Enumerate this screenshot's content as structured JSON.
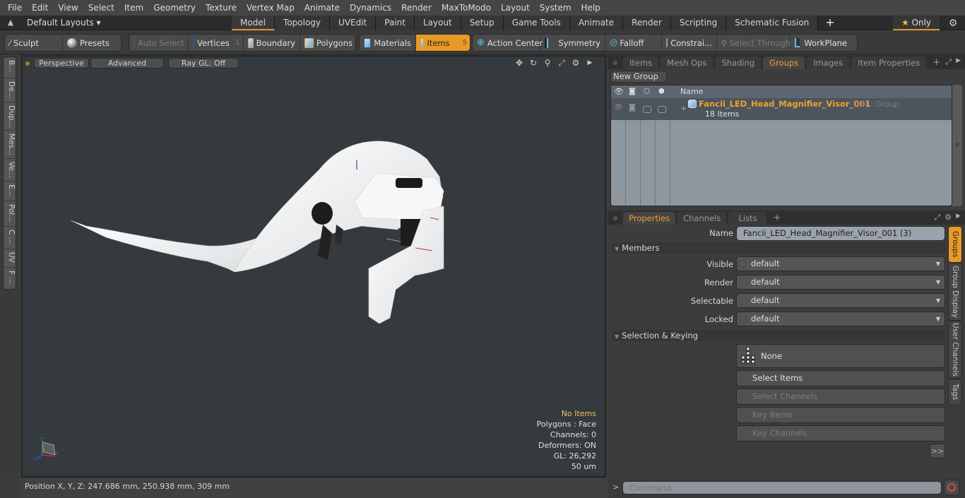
{
  "menu": [
    "File",
    "Edit",
    "View",
    "Select",
    "Item",
    "Geometry",
    "Texture",
    "Vertex Map",
    "Animate",
    "Dynamics",
    "Render",
    "MaxToModo",
    "Layout",
    "System",
    "Help"
  ],
  "layout_bar": {
    "layout_select": "Default Layouts ▾",
    "tabs": [
      {
        "label": "Model",
        "active": true
      },
      {
        "label": "Topology"
      },
      {
        "label": "UVEdit"
      },
      {
        "label": "Paint"
      },
      {
        "label": "Layout"
      },
      {
        "label": "Setup"
      },
      {
        "label": "Game Tools"
      },
      {
        "label": "Animate"
      },
      {
        "label": "Render"
      },
      {
        "label": "Scripting"
      },
      {
        "label": "Schematic Fusion"
      }
    ],
    "add_tab": "+",
    "only_label": "Only",
    "accent": "#e0962c"
  },
  "toolbar": {
    "sculpt": "Sculpt",
    "presets": "Presets",
    "auto_select": "Auto Select",
    "vertices": "Vertices",
    "vertices_count": "1",
    "boundary": "Boundary",
    "polygons": "Polygons",
    "materials": "Materials",
    "items": "Items",
    "items_count": "5",
    "action_center": "Action Center",
    "symmetry": "Symmetry",
    "falloff": "Falloff",
    "constraints": "Constrai...",
    "select_through": "Select Through",
    "workplane": "WorkPlane"
  },
  "left_tabs": [
    "B...",
    "De...",
    "Dup...",
    "Mes...",
    "Ve...",
    "E...",
    "Pol...",
    "C ...",
    "UV",
    "F ..."
  ],
  "viewport": {
    "view_mode": "Perspective",
    "shading": "Advanced",
    "raygl": "Ray GL: Off",
    "hud": {
      "selection": "No Items",
      "polygons": "Polygons : Face",
      "channels": "Channels: 0",
      "deformers": "Deformers: ON",
      "gl": "GL: 26,292",
      "scale": "50 um"
    },
    "axis_labels": {
      "x": "X",
      "y": "Y",
      "z": "Z"
    }
  },
  "status_bar": {
    "position": "Position X, Y, Z:   247.686 mm, 250.938 mm, 309 mm"
  },
  "groups_panel": {
    "tabs": [
      {
        "label": "Items"
      },
      {
        "label": "Mesh Ops"
      },
      {
        "label": "Shading"
      },
      {
        "label": "Groups",
        "active": true
      },
      {
        "label": "Images"
      },
      {
        "label": "Item Properties"
      }
    ],
    "new_group": "New Group",
    "column_name": "Name",
    "group": {
      "name": "Fancii_LED_Head_Magnifier_Visor_001",
      "count_suffix": "(3)",
      "type_suffix": ": Group",
      "items_count": "18 Items"
    }
  },
  "properties_panel": {
    "tabs": [
      {
        "label": "Properties",
        "active": true
      },
      {
        "label": "Channels"
      },
      {
        "label": "Lists"
      }
    ],
    "name_label": "Name",
    "name_value": "Fancii_LED_Head_Magnifier_Visor_001 (3)",
    "members_section": "Members",
    "fields": [
      {
        "label": "Visible",
        "value": "default"
      },
      {
        "label": "Render",
        "value": "default"
      },
      {
        "label": "Selectable",
        "value": "default"
      },
      {
        "label": "Locked",
        "value": "default"
      }
    ],
    "selection_section": "Selection & Keying",
    "selection_mode": "None",
    "buttons": [
      {
        "label": "Select Items",
        "enabled": true
      },
      {
        "label": "Select Channels",
        "enabled": false
      },
      {
        "label": "Key Items",
        "enabled": false
      },
      {
        "label": "Key Channels",
        "enabled": false
      }
    ],
    "more": ">>",
    "side_tabs": [
      {
        "label": "Groups",
        "active": true
      },
      {
        "label": "Group Display"
      },
      {
        "label": "User Channels"
      },
      {
        "label": "Tags"
      }
    ]
  },
  "command": {
    "prompt": ">",
    "placeholder": "Command"
  }
}
